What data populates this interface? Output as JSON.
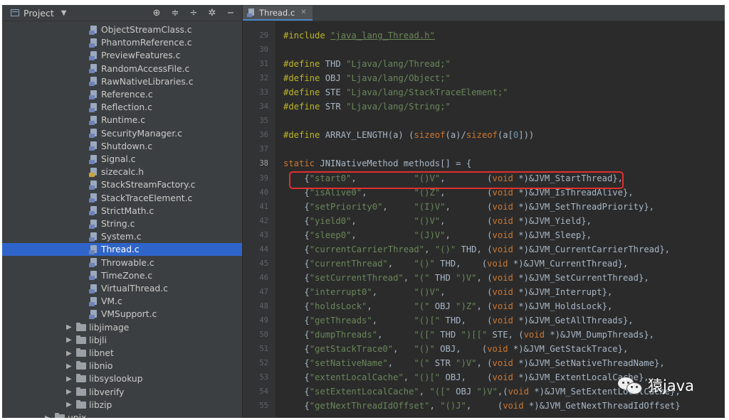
{
  "sidebar": {
    "title": "Project",
    "files": [
      {
        "label": "ObjectStreamClass.c",
        "kind": "c"
      },
      {
        "label": "PhantomReference.c",
        "kind": "c"
      },
      {
        "label": "PreviewFeatures.c",
        "kind": "c"
      },
      {
        "label": "RandomAccessFile.c",
        "kind": "c"
      },
      {
        "label": "RawNativeLibraries.c",
        "kind": "c"
      },
      {
        "label": "Reference.c",
        "kind": "c"
      },
      {
        "label": "Reflection.c",
        "kind": "c"
      },
      {
        "label": "Runtime.c",
        "kind": "c"
      },
      {
        "label": "SecurityManager.c",
        "kind": "c"
      },
      {
        "label": "Shutdown.c",
        "kind": "c"
      },
      {
        "label": "Signal.c",
        "kind": "c"
      },
      {
        "label": "sizecalc.h",
        "kind": "h"
      },
      {
        "label": "StackStreamFactory.c",
        "kind": "c"
      },
      {
        "label": "StackTraceElement.c",
        "kind": "c"
      },
      {
        "label": "StrictMath.c",
        "kind": "c"
      },
      {
        "label": "String.c",
        "kind": "c"
      },
      {
        "label": "System.c",
        "kind": "c"
      },
      {
        "label": "Thread.c",
        "kind": "c",
        "selected": true
      },
      {
        "label": "Throwable.c",
        "kind": "c"
      },
      {
        "label": "TimeZone.c",
        "kind": "c"
      },
      {
        "label": "VirtualThread.c",
        "kind": "c"
      },
      {
        "label": "VM.c",
        "kind": "c"
      },
      {
        "label": "VMSupport.c",
        "kind": "c"
      }
    ],
    "folders": [
      "libjimage",
      "libjli",
      "libnet",
      "libnio",
      "libsyslookup",
      "libverify",
      "libzip"
    ],
    "partial_folder": "unix"
  },
  "editor": {
    "tab_label": "Thread.c",
    "current_line": 38,
    "highlighted_line": 39,
    "lines": [
      {
        "n": 29,
        "segs": [
          [
            "pp",
            "#include "
          ],
          [
            "inc",
            "\"java_lang_Thread.h\""
          ]
        ]
      },
      {
        "n": 30,
        "segs": []
      },
      {
        "n": 31,
        "segs": [
          [
            "pp",
            "#define "
          ],
          [
            "t",
            "THD "
          ],
          [
            "str",
            "\"Ljava/lang/Thread;\""
          ]
        ]
      },
      {
        "n": 32,
        "segs": [
          [
            "pp",
            "#define "
          ],
          [
            "t",
            "OBJ "
          ],
          [
            "str",
            "\"Ljava/lang/Object;\""
          ]
        ]
      },
      {
        "n": 33,
        "segs": [
          [
            "pp",
            "#define "
          ],
          [
            "t",
            "STE "
          ],
          [
            "str",
            "\"Ljava/lang/StackTraceElement;\""
          ]
        ]
      },
      {
        "n": 34,
        "segs": [
          [
            "pp",
            "#define "
          ],
          [
            "t",
            "STR "
          ],
          [
            "str",
            "\"Ljava/lang/String;\""
          ]
        ]
      },
      {
        "n": 35,
        "segs": []
      },
      {
        "n": 36,
        "segs": [
          [
            "pp",
            "#define "
          ],
          [
            "t",
            "ARRAY_LENGTH(a) ("
          ],
          [
            "kw",
            "sizeof"
          ],
          [
            "t",
            "(a)/"
          ],
          [
            "kw",
            "sizeof"
          ],
          [
            "t",
            "(a["
          ],
          [
            "num",
            "0"
          ],
          [
            "t",
            "]))"
          ]
        ]
      },
      {
        "n": 37,
        "segs": []
      },
      {
        "n": 38,
        "segs": [
          [
            "kw",
            "static "
          ],
          [
            "t",
            "JNINativeMethod methods[] = {"
          ]
        ]
      },
      {
        "n": 39,
        "segs": [
          [
            "t",
            "    {"
          ],
          [
            "str",
            "\"start0\""
          ],
          [
            "t",
            ",           "
          ],
          [
            "str",
            "\"()V\""
          ],
          [
            "t",
            ",        ("
          ],
          [
            "kw",
            "void "
          ],
          [
            "t",
            "*)&JVM_StartThread},"
          ]
        ]
      },
      {
        "n": 40,
        "segs": [
          [
            "t",
            "    {"
          ],
          [
            "str",
            "\"isAlive0\""
          ],
          [
            "t",
            ",         "
          ],
          [
            "str",
            "\"()Z\""
          ],
          [
            "t",
            ",        ("
          ],
          [
            "kw",
            "void "
          ],
          [
            "t",
            "*)&JVM_IsThreadAlive},"
          ]
        ]
      },
      {
        "n": 41,
        "segs": [
          [
            "t",
            "    {"
          ],
          [
            "str",
            "\"setPriority0\""
          ],
          [
            "t",
            ",     "
          ],
          [
            "str",
            "\"(I)V\""
          ],
          [
            "t",
            ",       ("
          ],
          [
            "kw",
            "void "
          ],
          [
            "t",
            "*)&JVM_SetThreadPriority},"
          ]
        ]
      },
      {
        "n": 42,
        "segs": [
          [
            "t",
            "    {"
          ],
          [
            "str",
            "\"yield0\""
          ],
          [
            "t",
            ",           "
          ],
          [
            "str",
            "\"()V\""
          ],
          [
            "t",
            ",        ("
          ],
          [
            "kw",
            "void "
          ],
          [
            "t",
            "*)&JVM_Yield},"
          ]
        ]
      },
      {
        "n": 43,
        "segs": [
          [
            "t",
            "    {"
          ],
          [
            "str",
            "\"sleep0\""
          ],
          [
            "t",
            ",           "
          ],
          [
            "str",
            "\"(J)V\""
          ],
          [
            "t",
            ",       ("
          ],
          [
            "kw",
            "void "
          ],
          [
            "t",
            "*)&JVM_Sleep},"
          ]
        ]
      },
      {
        "n": 44,
        "segs": [
          [
            "t",
            "    {"
          ],
          [
            "str",
            "\"currentCarrierThread\""
          ],
          [
            "t",
            ", "
          ],
          [
            "str",
            "\"()\""
          ],
          [
            "t",
            " THD, ("
          ],
          [
            "kw",
            "void "
          ],
          [
            "t",
            "*)&JVM_CurrentCarrierThread},"
          ]
        ]
      },
      {
        "n": 45,
        "segs": [
          [
            "t",
            "    {"
          ],
          [
            "str",
            "\"currentThread\""
          ],
          [
            "t",
            ",    "
          ],
          [
            "str",
            "\"()\""
          ],
          [
            "t",
            " THD,    ("
          ],
          [
            "kw",
            "void "
          ],
          [
            "t",
            "*)&JVM_CurrentThread},"
          ]
        ]
      },
      {
        "n": 46,
        "segs": [
          [
            "t",
            "    {"
          ],
          [
            "str",
            "\"setCurrentThread\""
          ],
          [
            "t",
            ", "
          ],
          [
            "str",
            "\"(\""
          ],
          [
            "t",
            " THD "
          ],
          [
            "str",
            "\")V\""
          ],
          [
            "t",
            ", ("
          ],
          [
            "kw",
            "void "
          ],
          [
            "t",
            "*)&JVM_SetCurrentThread},"
          ]
        ]
      },
      {
        "n": 47,
        "segs": [
          [
            "t",
            "    {"
          ],
          [
            "str",
            "\"interrupt0\""
          ],
          [
            "t",
            ",       "
          ],
          [
            "str",
            "\"()V\""
          ],
          [
            "t",
            ",        ("
          ],
          [
            "kw",
            "void "
          ],
          [
            "t",
            "*)&JVM_Interrupt},"
          ]
        ]
      },
      {
        "n": 48,
        "segs": [
          [
            "t",
            "    {"
          ],
          [
            "str",
            "\"holdsLock\""
          ],
          [
            "t",
            ",        "
          ],
          [
            "str",
            "\"(\""
          ],
          [
            "t",
            " OBJ "
          ],
          [
            "str",
            "\")Z\""
          ],
          [
            "t",
            ", ("
          ],
          [
            "kw",
            "void "
          ],
          [
            "t",
            "*)&JVM_HoldsLock},"
          ]
        ]
      },
      {
        "n": 49,
        "segs": [
          [
            "t",
            "    {"
          ],
          [
            "str",
            "\"getThreads\""
          ],
          [
            "t",
            ",       "
          ],
          [
            "str",
            "\"()[\""
          ],
          [
            "t",
            " THD,    ("
          ],
          [
            "kw",
            "void "
          ],
          [
            "t",
            "*)&JVM_GetAllThreads},"
          ]
        ]
      },
      {
        "n": 50,
        "segs": [
          [
            "t",
            "    {"
          ],
          [
            "str",
            "\"dumpThreads\""
          ],
          [
            "t",
            ",      "
          ],
          [
            "str",
            "\"([\""
          ],
          [
            "t",
            " THD "
          ],
          [
            "str",
            "\")[[\""
          ],
          [
            "t",
            " STE, ("
          ],
          [
            "kw",
            "void "
          ],
          [
            "t",
            "*)&JVM_DumpThreads},"
          ]
        ]
      },
      {
        "n": 51,
        "segs": [
          [
            "t",
            "    {"
          ],
          [
            "str",
            "\"getStackTrace0\""
          ],
          [
            "t",
            ",   "
          ],
          [
            "str",
            "\"()\""
          ],
          [
            "t",
            " OBJ,    ("
          ],
          [
            "kw",
            "void "
          ],
          [
            "t",
            "*)&JVM_GetStackTrace},"
          ]
        ]
      },
      {
        "n": 52,
        "segs": [
          [
            "t",
            "    {"
          ],
          [
            "str",
            "\"setNativeName\""
          ],
          [
            "t",
            ",    "
          ],
          [
            "str",
            "\"(\""
          ],
          [
            "t",
            " STR "
          ],
          [
            "str",
            "\")V\""
          ],
          [
            "t",
            ", ("
          ],
          [
            "kw",
            "void "
          ],
          [
            "t",
            "*)&JVM_SetNativeThreadName},"
          ]
        ]
      },
      {
        "n": 53,
        "segs": [
          [
            "t",
            "    {"
          ],
          [
            "str",
            "\"extentLocalCache\""
          ],
          [
            "t",
            ", "
          ],
          [
            "str",
            "\"()[\""
          ],
          [
            "t",
            " OBJ,    ("
          ],
          [
            "kw",
            "void "
          ],
          [
            "t",
            "*)&JVM_ExtentLocalCache},"
          ]
        ]
      },
      {
        "n": 54,
        "segs": [
          [
            "t",
            "    {"
          ],
          [
            "str",
            "\"setExtentLocalCache\""
          ],
          [
            "t",
            ", "
          ],
          [
            "str",
            "\"([\""
          ],
          [
            "t",
            " OBJ "
          ],
          [
            "str",
            "\")V\""
          ],
          [
            "t",
            ",("
          ],
          [
            "kw",
            "void "
          ],
          [
            "t",
            "*)&JVM_SetExtentLocalCache},"
          ]
        ]
      },
      {
        "n": 55,
        "segs": [
          [
            "t",
            "    {"
          ],
          [
            "str",
            "\"getNextThreadIdOffset\""
          ],
          [
            "t",
            ", "
          ],
          [
            "str",
            "\"()J\""
          ],
          [
            "t",
            ",     ("
          ],
          [
            "kw",
            "void "
          ],
          [
            "t",
            "*)&JVM_GetNextThreadIdOffset}"
          ]
        ]
      }
    ]
  },
  "watermark": {
    "text": "猿java",
    "icon": "wechat-icon"
  },
  "colors": {
    "highlight_box": "#e0302f",
    "selection": "#2f65ca"
  }
}
